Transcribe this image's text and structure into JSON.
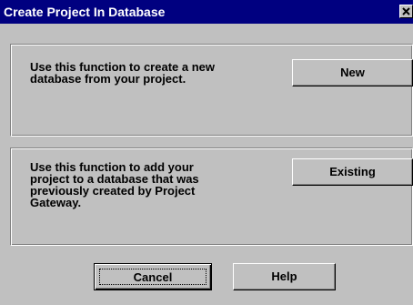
{
  "window": {
    "title": "Create Project In Database",
    "close_glyph": "×"
  },
  "new_section": {
    "description": "Use this function to create a new\ndatabase from your project.",
    "button_label": "New"
  },
  "existing_section": {
    "description": "Use this function to add your\nproject to a database that was\npreviously created by Project\nGateway.",
    "button_label": "Existing"
  },
  "footer": {
    "cancel_label": "Cancel",
    "help_label": "Help"
  },
  "colors": {
    "titlebar": "#000080",
    "title_text": "#ffffff",
    "dialog_face": "#c0c0c0"
  },
  "icons": {
    "close": "close-icon"
  }
}
